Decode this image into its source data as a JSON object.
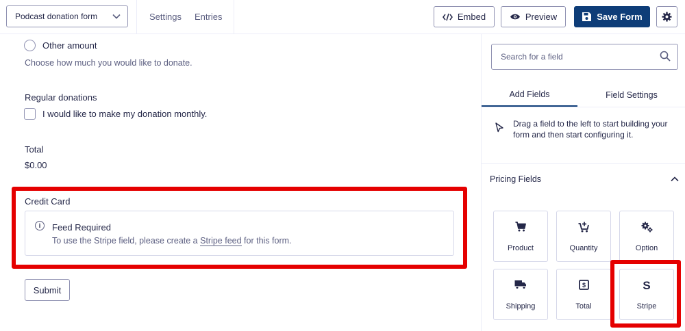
{
  "header": {
    "form_name": "Podcast donation form",
    "links": {
      "settings": "Settings",
      "entries": "Entries"
    },
    "buttons": {
      "embed": "Embed",
      "preview": "Preview",
      "save": "Save Form"
    }
  },
  "form": {
    "option_label": "Other amount",
    "donation_description": "Choose how much you would like to donate.",
    "regular_donations": {
      "label": "Regular donations",
      "checkbox_label": "I would like to make my donation monthly."
    },
    "total": {
      "label": "Total",
      "value": "$0.00"
    },
    "credit_card": {
      "label": "Credit Card",
      "notice_title": "Feed Required",
      "notice_before": "To use the Stripe field, please create a ",
      "notice_link": "Stripe feed",
      "notice_after": " for this form."
    },
    "submit_label": "Submit"
  },
  "sidebar": {
    "search_placeholder": "Search for a field",
    "tabs": {
      "add_fields": "Add Fields",
      "field_settings": "Field Settings"
    },
    "hint": "Drag a field to the left to start building your form and then start configuring it.",
    "group_title": "Pricing Fields",
    "fields": [
      {
        "label": "Product",
        "icon": "cart-icon"
      },
      {
        "label": "Quantity",
        "icon": "cart-plus-icon"
      },
      {
        "label": "Option",
        "icon": "gears-icon"
      },
      {
        "label": "Shipping",
        "icon": "truck-icon"
      },
      {
        "label": "Total",
        "icon": "dollar-box-icon"
      },
      {
        "label": "Stripe",
        "icon": "stripe-icon"
      }
    ]
  },
  "colors": {
    "highlight": "#e50000",
    "save_button": "#0e3d78",
    "text": "#242748",
    "muted_text": "#5b5e80"
  }
}
